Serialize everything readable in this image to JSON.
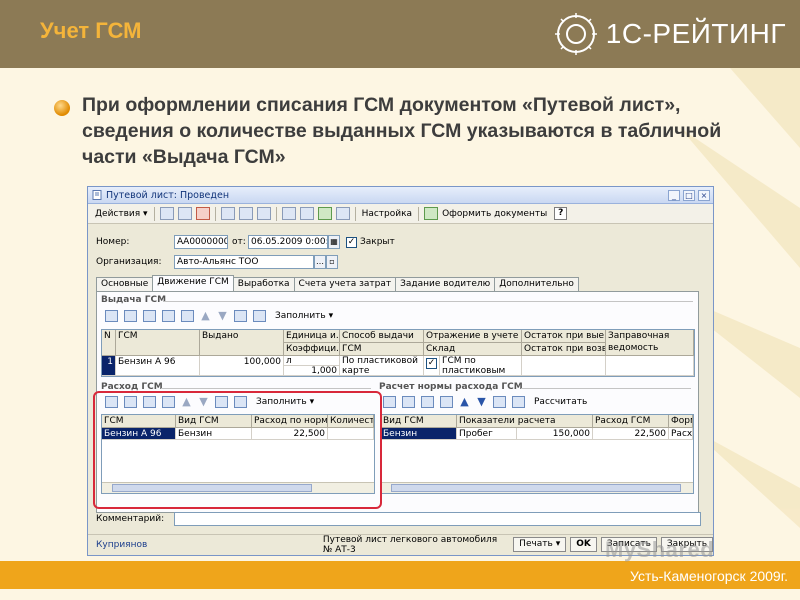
{
  "slide": {
    "title": "Учет ГСМ",
    "brand": "1С-РЕЙТИНГ",
    "bullet": "При оформлении списания ГСМ документом «Путевой лист», сведения о количестве выданных ГСМ указываются в табличной части «Выдача ГСМ»",
    "footer": "Усть-Каменогорск 2009г.",
    "watermark": "MyShared"
  },
  "colors": {
    "header": "#8c7a55",
    "title": "#f4b43a",
    "footer": "#efa51b",
    "highlight": "#d8283a",
    "selection": "#0a246a"
  },
  "window": {
    "title": "Путевой лист: Проведен",
    "controls": [
      "_",
      "□",
      "×"
    ],
    "toolbar": {
      "actions": "Действия",
      "settings": "Настройка",
      "make_docs": "Оформить документы",
      "help": "?"
    },
    "header": {
      "number_label": "Номер:",
      "number_value": "АА0000000",
      "date_label": "от:",
      "date_value": "06.05.2009 0:00:00",
      "closed_label": "Закрыт",
      "org_label": "Организация:",
      "org_value": "Авто-Альянс ТОО"
    },
    "tabs": [
      "Основные",
      "Движение ГСМ",
      "Выработка",
      "Счета учета затрат",
      "Задание водителю",
      "Дополнительно"
    ],
    "issue": {
      "title": "Выдача ГСМ",
      "columns": {
        "n": "N",
        "fuel": "ГСМ",
        "issued": "Выдано",
        "unit": "Единица и...",
        "coef": "Коэффици...",
        "method": "Способ выдачи",
        "method_sub": "ГСМ",
        "reflect": "Отражение в учете",
        "warehouse": "Склад",
        "rest_out": "Остаток при вые...",
        "rest_ret": "Остаток при возв...",
        "sheet": "Заправочная ведомость"
      },
      "row": {
        "n": "1",
        "fuel": "Бензин А 96",
        "issued": "100,000",
        "unit": "л",
        "coef": "1,000",
        "method": "По пластиковой карте",
        "warehouse": "ГСМ по пластиковым"
      }
    },
    "consumption": {
      "title": "Расход ГСМ",
      "fill": "Заполнить",
      "columns": [
        "ГСМ",
        "Вид ГСМ",
        "Расход по норме",
        "Количество"
      ],
      "row": [
        "Бензин А 96",
        "Бензин",
        "22,500",
        ""
      ]
    },
    "norm": {
      "title": "Расчет нормы расхода ГСМ",
      "calc": "Рассчитать",
      "columns": [
        "Вид ГСМ",
        "Показатели расчета",
        "Расход ГСМ",
        "Форм"
      ],
      "row": [
        "Бензин",
        "Пробег",
        "150,000",
        "22,500",
        "Расхо"
      ]
    },
    "fill_issue": "Заполнить",
    "comment_label": "Комментарий:",
    "status": {
      "user": "Куприянов",
      "form_name": "Путевой лист легкового автомобиля № АТ-3",
      "print": "Печать",
      "ok": "OK",
      "save": "Записать",
      "close": "Закрыть"
    }
  }
}
